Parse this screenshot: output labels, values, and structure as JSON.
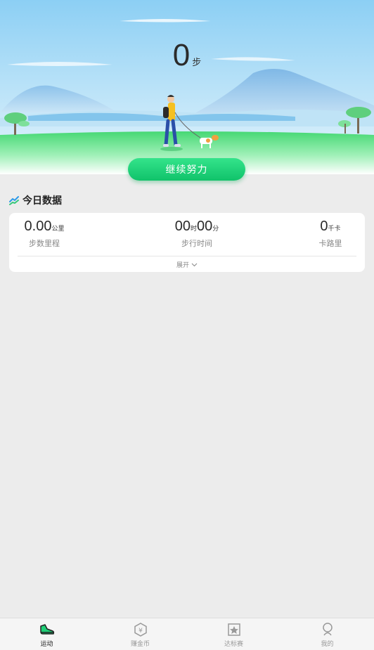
{
  "hero": {
    "steps_value": "0",
    "steps_unit": "步",
    "cta_label": "继续努力"
  },
  "today": {
    "title": "今日数据",
    "distance": {
      "value": "0.00",
      "unit": "公里",
      "label": "步数里程"
    },
    "time": {
      "hours": "00",
      "hours_unit": "时",
      "minutes": "00",
      "minutes_unit": "分",
      "label": "步行时间"
    },
    "calories": {
      "value": "0",
      "unit": "千卡",
      "label": "卡路里"
    },
    "expand_label": "展开"
  },
  "tabs": [
    {
      "label": "运动",
      "icon": "shoe-icon",
      "active": true
    },
    {
      "label": "赚金币",
      "icon": "coin-hexagon-icon",
      "active": false
    },
    {
      "label": "达标赛",
      "icon": "star-trophy-icon",
      "active": false
    },
    {
      "label": "我的",
      "icon": "profile-icon",
      "active": false
    }
  ],
  "colors": {
    "accent": "#1fcf77",
    "sky": "#9fd6f5",
    "grass": "#5ee07f"
  }
}
